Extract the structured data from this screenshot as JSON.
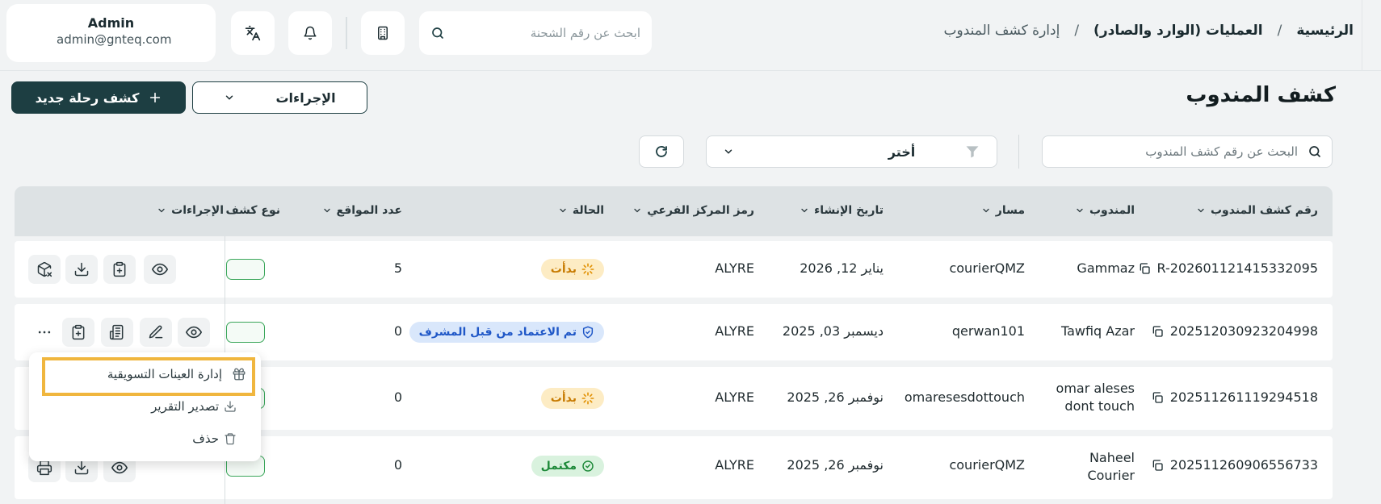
{
  "user": {
    "name": "Admin",
    "email": "admin@gnteq.com"
  },
  "header": {
    "search_placeholder": "ابحث عن رقم الشحنة",
    "breadcrumb": [
      "الرئيسية",
      "العمليات (الوارد والصادر)",
      "إدارة كشف المندوب"
    ],
    "breadcrumb_sep": "/"
  },
  "page": {
    "title": "كشف المندوب",
    "new_button": "كشف رحلة جديد",
    "actions_button": "الإجراءات"
  },
  "filters": {
    "search_placeholder": "البحث عن رقم كشف المندوب",
    "select_value": "أختر"
  },
  "table": {
    "columns": [
      "رقم كشف المندوب",
      "المندوب",
      "مسار",
      "تاريخ الإنشاء",
      "رمز المركز الفرعي",
      "الحالة",
      "عدد المواقع",
      "نوع كشف",
      "الإجراءات"
    ],
    "rows": [
      {
        "id": "R-202601121415332095",
        "courier": [
          "Gammaz"
        ],
        "route": "courierQMZ",
        "date": "يناير 12, 2026",
        "branch": "ALYRE",
        "status": "بدأت",
        "status_kind": "started",
        "locations": "5"
      },
      {
        "id": "202512030923204998",
        "courier": [
          "Tawfiq Azar"
        ],
        "route": "qerwan101",
        "date": "ديسمبر 03, 2025",
        "branch": "ALYRE",
        "status": "تم الاعتماد من قبل المشرف",
        "status_kind": "approved",
        "locations": "0"
      },
      {
        "id": "202511261119294518",
        "courier": [
          "omar aleses",
          "dont touch"
        ],
        "route": "omaresesdottouch",
        "date": "نوفمبر 26, 2025",
        "branch": "ALYRE",
        "status": "بدأت",
        "status_kind": "started",
        "locations": "0"
      },
      {
        "id": "202511260906556733",
        "courier": [
          "Naheel",
          "Courier"
        ],
        "route": "courierQMZ",
        "date": "نوفمبر 26, 2025",
        "branch": "ALYRE",
        "status": "مكتمل",
        "status_kind": "done",
        "locations": "0"
      }
    ]
  },
  "menu": {
    "items": [
      "إدارة العينات التسويقية",
      "تصدير التقرير",
      "حذف"
    ]
  },
  "colors": {
    "primary": "#1d3e42",
    "highlight": "#f0b63e",
    "started": "#c77a00",
    "approved": "#1f57c7",
    "done": "#1f8a3a"
  }
}
